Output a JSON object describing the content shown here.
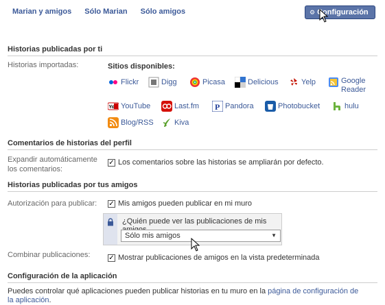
{
  "tabs": [
    "Marian y amigos",
    "Sólo Marian",
    "Sólo amigos"
  ],
  "config_button": "Configuración",
  "sections": {
    "historias": "Historias publicadas por ti",
    "comentarios": "Comentarios de historias del perfil",
    "amigos": "Historias publicadas por tus amigos",
    "aplicacion": "Configuración de la aplicación"
  },
  "labels": {
    "importadas": "Historias importadas:",
    "expandir": "Expandir automáticamente\nlos comentarios:",
    "autorizacion": "Autorización para publicar:",
    "combinar": "Combinar publicaciones:"
  },
  "sitios_title": "Sitios disponibles:",
  "sites": {
    "flickr": "Flickr",
    "digg": "Digg",
    "picasa": "Picasa",
    "delicious": "Delicious",
    "yelp": "Yelp",
    "google_reader": "Google\nReader",
    "youtube": "YouTube",
    "lastfm": "Last.fm",
    "pandora": "Pandora",
    "photobucket": "Photobucket",
    "hulu": "hulu",
    "blogrss": "Blog/RSS",
    "kiva": "Kiva"
  },
  "checks": {
    "comentarios": "Los comentarios sobre las historias se ampliarán por defecto.",
    "publicar": "Mis amigos pueden publicar en mi muro",
    "combinar": "Mostrar publicaciones de amigos en la vista predeterminada"
  },
  "privacy": {
    "question": "¿Quién puede ver las publicaciones de mis amigos",
    "selected": "Sólo mis amigos"
  },
  "bottom": {
    "text": "Puedes controlar qué aplicaciones pueden publicar historias en tu muro en la ",
    "link": "página de configuración de la aplicación",
    "end": "."
  },
  "icons": [
    "gear-icon",
    "cursor-icon",
    "flickr-icon",
    "digg-icon",
    "picasa-icon",
    "delicious-icon",
    "yelp-icon",
    "google-reader-icon",
    "youtube-icon",
    "lastfm-icon",
    "pandora-icon",
    "photobucket-icon",
    "hulu-icon",
    "rss-icon",
    "kiva-icon",
    "lock-icon",
    "chevron-down-icon"
  ]
}
